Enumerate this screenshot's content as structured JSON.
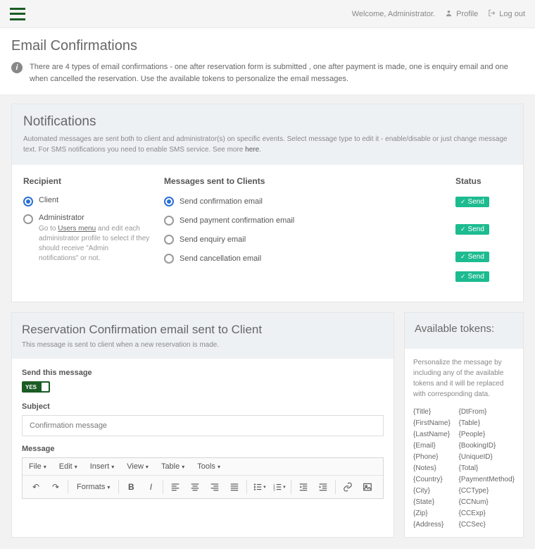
{
  "topbar": {
    "welcome": "Welcome, Administrator.",
    "profile": "Profile",
    "logout": "Log out"
  },
  "page": {
    "title": "Email Confirmations",
    "info": "There are 4 types of email confirmations - one after reservation form is submitted , one after payment is made, one is enquiry email and one when cancelled the reservation. Use the available tokens to personalize the email messages."
  },
  "notifications": {
    "title": "Notifications",
    "sub_pre": "Automated messages are sent both to client and administrator(s) on specific events. Select message type to edit it - enable/disable or just change message text. For SMS notifications you need to enable SMS service. See more ",
    "sub_link": "here",
    "sub_post": ".",
    "recipient_header": "Recipient",
    "messages_header": "Messages sent to Clients",
    "status_header": "Status",
    "recipients": [
      {
        "label": "Client",
        "checked": true,
        "help": ""
      },
      {
        "label": "Administrator",
        "checked": false,
        "help_pre": "Go to ",
        "help_link": "Users menu",
        "help_post": " and edit each administrator profile to select if they should receive \"Admin notifications\" or not."
      }
    ],
    "messages": [
      {
        "label": "Send confirmation email",
        "checked": true,
        "status": "Send"
      },
      {
        "label": "Send payment confirmation email",
        "checked": false,
        "status": "Send"
      },
      {
        "label": "Send enquiry email",
        "checked": false,
        "status": "Send"
      },
      {
        "label": "Send cancellation email",
        "checked": false,
        "status": "Send"
      }
    ]
  },
  "editorPanel": {
    "title": "Reservation Confirmation email sent to Client",
    "sub": "This message is sent to client when a new reservation is made.",
    "send_label": "Send this message",
    "toggle_value": "YES",
    "subject_label": "Subject",
    "subject_value": "Confirmation message",
    "message_label": "Message",
    "menu": {
      "file": "File",
      "edit": "Edit",
      "insert": "Insert",
      "view": "View",
      "table": "Table",
      "tools": "Tools"
    },
    "formats": "Formats"
  },
  "tokens": {
    "title": "Available tokens:",
    "desc": "Personalize the message by including any of the available tokens and it will be replaced with corresponding data.",
    "left": [
      "{Title}",
      "{FirstName}",
      "{LastName}",
      "{Email}",
      "{Phone}",
      "{Notes}",
      "{Country}",
      "{City}",
      "{State}",
      "{Zip}",
      "{Address}"
    ],
    "right": [
      "{DtFrom}",
      "{Table}",
      "{People}",
      "{BookingID}",
      "{UniqueID}",
      "{Total}",
      "{PaymentMethod}",
      "{CCType}",
      "{CCNum}",
      "{CCExp}",
      "{CCSec}"
    ]
  }
}
